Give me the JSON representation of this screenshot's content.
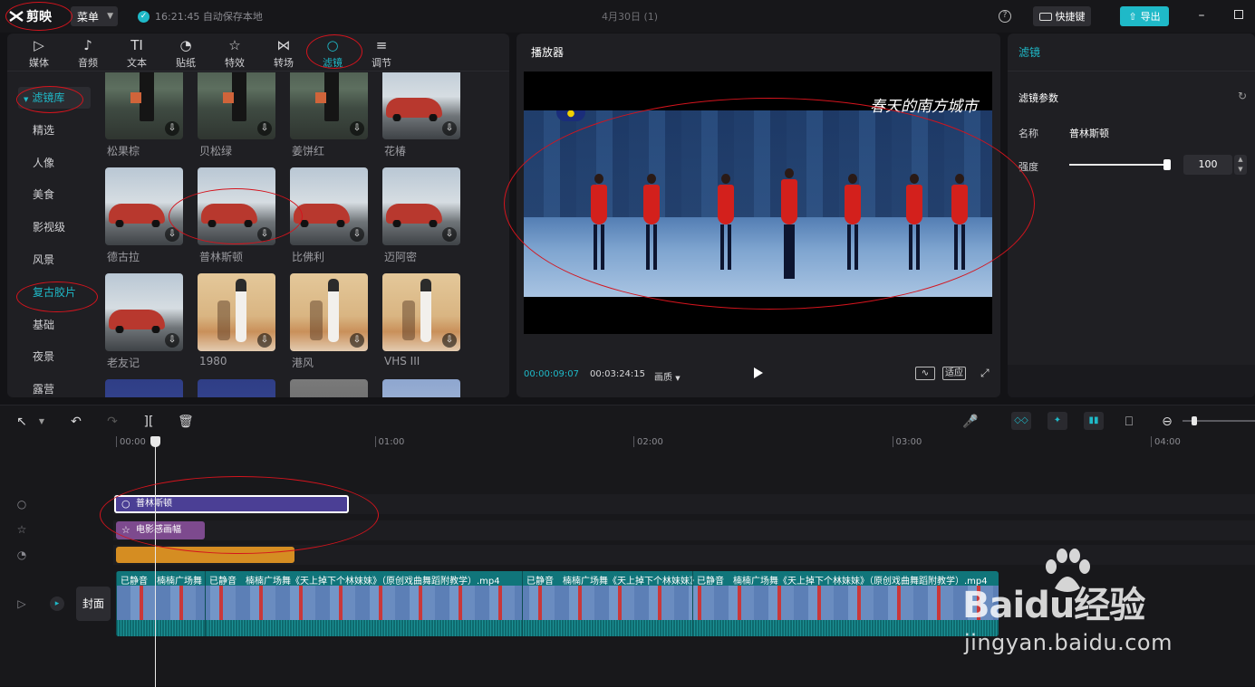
{
  "app": {
    "logo_text": "剪映",
    "menu_label": "菜单",
    "save_status": "16:21:45 自动保存本地",
    "document_title": "4月30日 (1)",
    "shortcut_label": "快捷键",
    "export_label": "导出"
  },
  "media_tabs": [
    {
      "label": "媒体",
      "icon": "media-icon"
    },
    {
      "label": "音频",
      "icon": "audio-icon"
    },
    {
      "label": "文本",
      "icon": "text-icon"
    },
    {
      "label": "贴纸",
      "icon": "sticker-icon"
    },
    {
      "label": "特效",
      "icon": "effects-icon"
    },
    {
      "label": "转场",
      "icon": "transition-icon"
    },
    {
      "label": "滤镜",
      "icon": "filter-icon"
    },
    {
      "label": "调节",
      "icon": "adjust-icon"
    }
  ],
  "active_tab": "滤镜",
  "filter_categories": [
    "滤镜库",
    "精选",
    "人像",
    "美食",
    "影视级",
    "风景",
    "复古胶片",
    "基础",
    "夜景",
    "露营"
  ],
  "selected_category": "复古胶片",
  "filters": [
    {
      "name": "松果棕",
      "art": "girl"
    },
    {
      "name": "贝松绿",
      "art": "girl"
    },
    {
      "name": "姜饼红",
      "art": "girl"
    },
    {
      "name": "花椿",
      "art": "car"
    },
    {
      "name": "德古拉",
      "art": "car"
    },
    {
      "name": "普林斯顿",
      "art": "car"
    },
    {
      "name": "比佛利",
      "art": "car"
    },
    {
      "name": "迈阿密",
      "art": "car"
    },
    {
      "name": "老友记",
      "art": "car"
    },
    {
      "name": "1980",
      "art": "walk"
    },
    {
      "name": "港风",
      "art": "walk"
    },
    {
      "name": "VHS III",
      "art": "walk"
    },
    {
      "name": "",
      "art": "blue"
    },
    {
      "name": "",
      "art": "blue"
    },
    {
      "name": "",
      "art": "gray"
    },
    {
      "name": "",
      "art": "sky"
    }
  ],
  "player": {
    "title": "播放器",
    "current_time": "00:00:09:07",
    "total_time": "00:03:24:15",
    "quality_label": "画质",
    "fit_label": "适应",
    "video_caption": "春天的南方城市"
  },
  "properties": {
    "title": "滤镜",
    "section_label": "滤镜参数",
    "name_label": "名称",
    "name_value": "普林斯顿",
    "strength_label": "强度",
    "strength_value": "100",
    "strength_fraction": 1.0
  },
  "timeline": {
    "ruler_labels": [
      "00:00",
      "01:00",
      "02:00",
      "03:00",
      "04:00"
    ],
    "filter_clip": "普林斯顿",
    "effect_clip": "电影感画幅",
    "cover_label": "封面",
    "video_segments": [
      {
        "muted": "已静音",
        "name": "楠楠广场舞"
      },
      {
        "muted": "已静音",
        "name": "楠楠广场舞《天上掉下个林妹妹》（原创戏曲舞蹈附教学）.mp4"
      },
      {
        "muted": "已静音",
        "name": "楠楠广场舞《天上掉下个林妹妹》"
      },
      {
        "muted": "已静音",
        "name": "楠楠广场舞《天上掉下个林妹妹》（原创戏曲舞蹈附教学）.mp4"
      }
    ]
  },
  "watermark": {
    "brand": "Baidu经验",
    "site": "jingyan.baidu.com"
  },
  "colors": {
    "accent": "#1fb9c8",
    "annotation": "#d4141d",
    "filter_clip": "#4b3f95",
    "effect_clip": "#7d4a8e",
    "adjust_clip": "#d58d22",
    "video_track": "#10757a"
  }
}
